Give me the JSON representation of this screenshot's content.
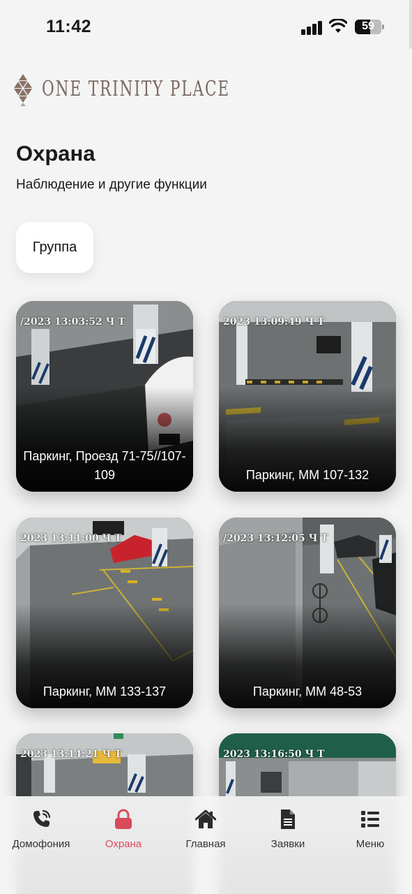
{
  "status_bar": {
    "time": "11:42",
    "battery": "59",
    "battery_level": 0.59
  },
  "logo": {
    "text": "ONE TRINITY PLACE"
  },
  "page": {
    "title": "Охрана",
    "subtitle": "Наблюдение и другие функции"
  },
  "filter": {
    "group_label": "Группа"
  },
  "cameras": [
    {
      "label": "Паркинг, Проезд 71-75//107-109",
      "timestamp": "/2023 13:03:52 Ч Т"
    },
    {
      "label": "Паркинг, ММ 107-132",
      "timestamp": "2023 13:09:49 Ч Т"
    },
    {
      "label": "Паркинг, ММ 133-137",
      "timestamp": "2023 13:11:00 Ч Т"
    },
    {
      "label": "Паркинг, ММ 48-53",
      "timestamp": "/2023 13:12:05 Ч Т"
    },
    {
      "label": "",
      "timestamp": "2023 13:14:21 Ч Т"
    },
    {
      "label": "",
      "timestamp": "2023 13:16:50 Ч Т"
    }
  ],
  "nav": {
    "items": [
      {
        "label": "Домофония",
        "icon": "phone-icon"
      },
      {
        "label": "Охрана",
        "icon": "lock-icon",
        "active": true
      },
      {
        "label": "Главная",
        "icon": "home-icon"
      },
      {
        "label": "Заявки",
        "icon": "document-icon"
      },
      {
        "label": "Меню",
        "icon": "menu-list-icon"
      }
    ]
  },
  "colors": {
    "accent": "#d94a5c",
    "background": "#f4f4f4",
    "logo": "#7b6a62"
  }
}
